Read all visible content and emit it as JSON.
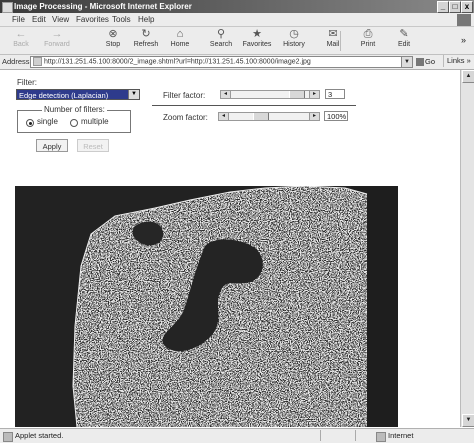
{
  "window": {
    "title": "Image Processing - Microsoft Internet Explorer",
    "minimize": "_",
    "maximize": "□",
    "close": "x"
  },
  "menu": [
    "File",
    "Edit",
    "View",
    "Favorites",
    "Tools",
    "Help"
  ],
  "toolbar": {
    "buttons": [
      {
        "label": "Back",
        "icon": "back-arrow-icon",
        "glyph": "←",
        "enabled": false
      },
      {
        "label": "Forward",
        "icon": "forward-arrow-icon",
        "glyph": "→",
        "enabled": false
      },
      {
        "label": "Stop",
        "icon": "stop-icon",
        "glyph": "⊗",
        "enabled": true
      },
      {
        "label": "Refresh",
        "icon": "refresh-icon",
        "glyph": "↻",
        "enabled": true
      },
      {
        "label": "Home",
        "icon": "home-icon",
        "glyph": "⌂",
        "enabled": true
      },
      {
        "label": "Search",
        "icon": "search-icon",
        "glyph": "⚲",
        "enabled": true
      },
      {
        "label": "Favorites",
        "icon": "favorites-icon",
        "glyph": "★",
        "enabled": true
      },
      {
        "label": "History",
        "icon": "history-icon",
        "glyph": "◷",
        "enabled": true
      },
      {
        "label": "Mail",
        "icon": "mail-icon",
        "glyph": "✉",
        "enabled": true
      },
      {
        "label": "Print",
        "icon": "print-icon",
        "glyph": "⎙",
        "enabled": true
      },
      {
        "label": "Edit",
        "icon": "edit-icon",
        "glyph": "✎",
        "enabled": true
      }
    ],
    "overflow": "»"
  },
  "address": {
    "label": "Address",
    "url": "http://131.251.45.100:8000/2_image.shtml?url=http://131.251.45.100:8000/image2.jpg",
    "go_label": "Go",
    "links_label": "Links »"
  },
  "form": {
    "filter_label": "Filter:",
    "filter_value": "Edge detection (Laplacian)",
    "filter_factor_label": "Filter factor:",
    "filter_factor_value": "3",
    "zoom_factor_label": "Zoom factor:",
    "zoom_factor_value": "100%",
    "number_of_filters_label": "Number of filters:",
    "single_label": "single",
    "multiple_label": "multiple",
    "selected": "single",
    "apply_button": "Apply",
    "reset_button": "Reset"
  },
  "status": {
    "text": "Applet started.",
    "zone": "Internet"
  }
}
